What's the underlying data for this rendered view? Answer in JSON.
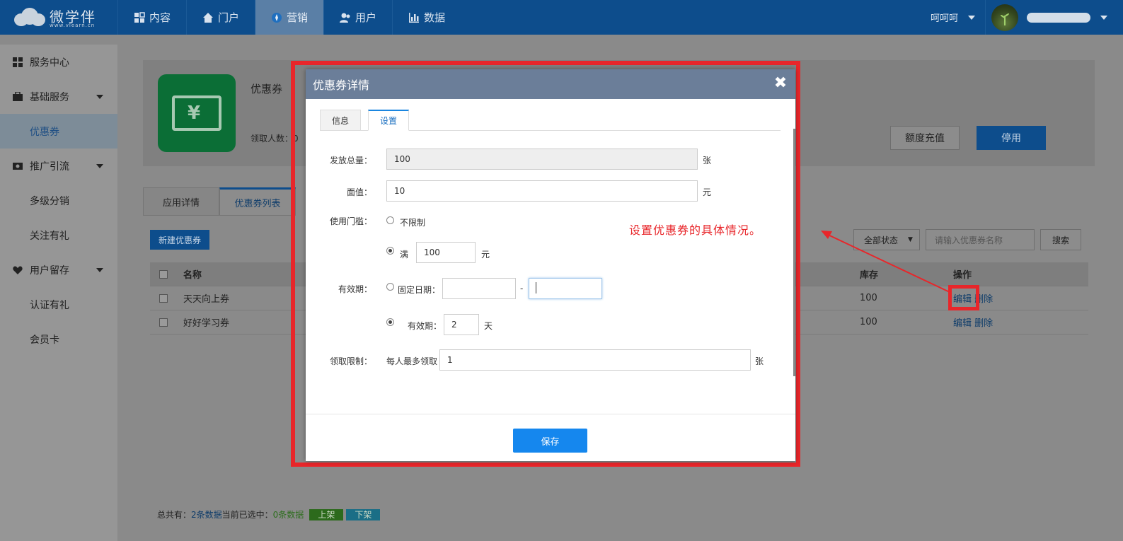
{
  "topbar": {
    "logo_text": "微学伴",
    "logo_sub": "www.vlearn.cn",
    "nav": [
      {
        "label": "内容",
        "icon": "grid-icon"
      },
      {
        "label": "门户",
        "icon": "home-icon"
      },
      {
        "label": "营销",
        "icon": "compass-icon",
        "active": true
      },
      {
        "label": "用户",
        "icon": "users-icon"
      },
      {
        "label": "数据",
        "icon": "bar-chart-icon"
      }
    ],
    "username": "呵呵呵"
  },
  "sidebar": {
    "items": [
      {
        "label": "服务中心",
        "icon": "grid-icon"
      },
      {
        "label": "基础服务",
        "icon": "briefcase-icon",
        "dropdown": true
      },
      {
        "label": "优惠券",
        "selected": true
      },
      {
        "label": "推广引流",
        "icon": "money-icon",
        "dropdown": true
      },
      {
        "label": "多级分销"
      },
      {
        "label": "关注有礼"
      },
      {
        "label": "用户留存",
        "icon": "heart-icon",
        "dropdown": true
      },
      {
        "label": "认证有礼"
      },
      {
        "label": "会员卡"
      }
    ]
  },
  "main": {
    "app_title": "优惠券",
    "app_stat": "领取人数：0",
    "recharge_button": "额度充值",
    "stop_button": "停用",
    "tabs": [
      "应用详情",
      "优惠券列表"
    ],
    "new_button": "新建优惠券",
    "status_select": "全部状态",
    "search_placeholder": "请输入优惠券名称",
    "search_button": "搜索",
    "table": {
      "headers": {
        "name": "名称",
        "stock": "库存",
        "op": "操作"
      },
      "rows": [
        {
          "name": "天天向上券",
          "stock": "100",
          "edit": "编辑",
          "delete": "删除"
        },
        {
          "name": "好好学习券",
          "stock": "100",
          "edit": "编辑",
          "delete": "删除"
        }
      ]
    },
    "footer": {
      "total_prefix": "总共有：",
      "total_value": "2条数据",
      "selected_prefix": " 当前已选中：",
      "selected_value": "0条数据",
      "btn_up": "上架",
      "btn_down": "下架"
    }
  },
  "modal": {
    "title": "优惠券详情",
    "tabs": [
      "信息",
      "设置"
    ],
    "fields": {
      "total_label": "发放总量：",
      "total_value": "100",
      "total_unit": "张",
      "face_label": "面值：",
      "face_value": "10",
      "face_unit": "元",
      "threshold_label": "使用门槛：",
      "unlimited": "不限制",
      "full_label": "满",
      "full_value": "100",
      "full_unit": "元",
      "valid_label": "有效期：",
      "fixed_date": "固定日期：",
      "date_sep": "-",
      "valid_days_label": "有效期：",
      "valid_days_value": "2",
      "valid_days_unit": "天",
      "limit_label": "领取限制：",
      "limit_prefix": "每人最多领取",
      "limit_value": "1",
      "limit_unit": "张"
    },
    "save_button": "保存"
  },
  "annotation": "设置优惠券的具体情况。",
  "colors": {
    "nav_bg": "#0d4d8c",
    "highlight": "#e8262a",
    "primary": "#1587ee",
    "modal_head": "#6b7e99"
  }
}
